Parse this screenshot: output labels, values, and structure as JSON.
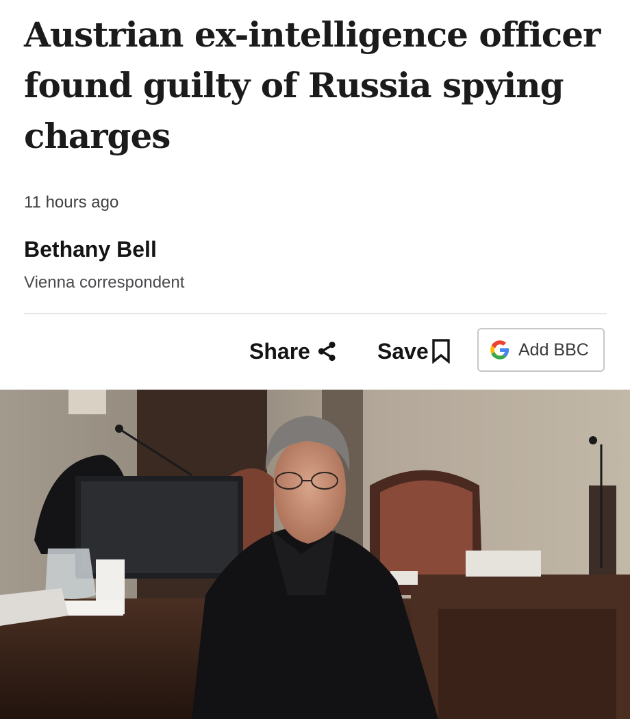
{
  "article": {
    "headline": "Austrian ex-intelligence officer found guilty of Russia spying charges",
    "timestamp": "11 hours ago",
    "author_name": "Bethany Bell",
    "author_role": "Vienna correspondent"
  },
  "actions": {
    "share_label": "Share",
    "save_label": "Save",
    "add_source_label": "Add BBC",
    "share_icon": "share-icon",
    "save_icon": "bookmark-icon",
    "add_icon": "google-g-icon"
  },
  "colors": {
    "text": "#141414",
    "muted": "#4a4a4e",
    "divider": "#e6e6e6",
    "google_blue": "#4285F4",
    "google_red": "#EA4335",
    "google_yellow": "#FBBC05",
    "google_green": "#34A853"
  }
}
